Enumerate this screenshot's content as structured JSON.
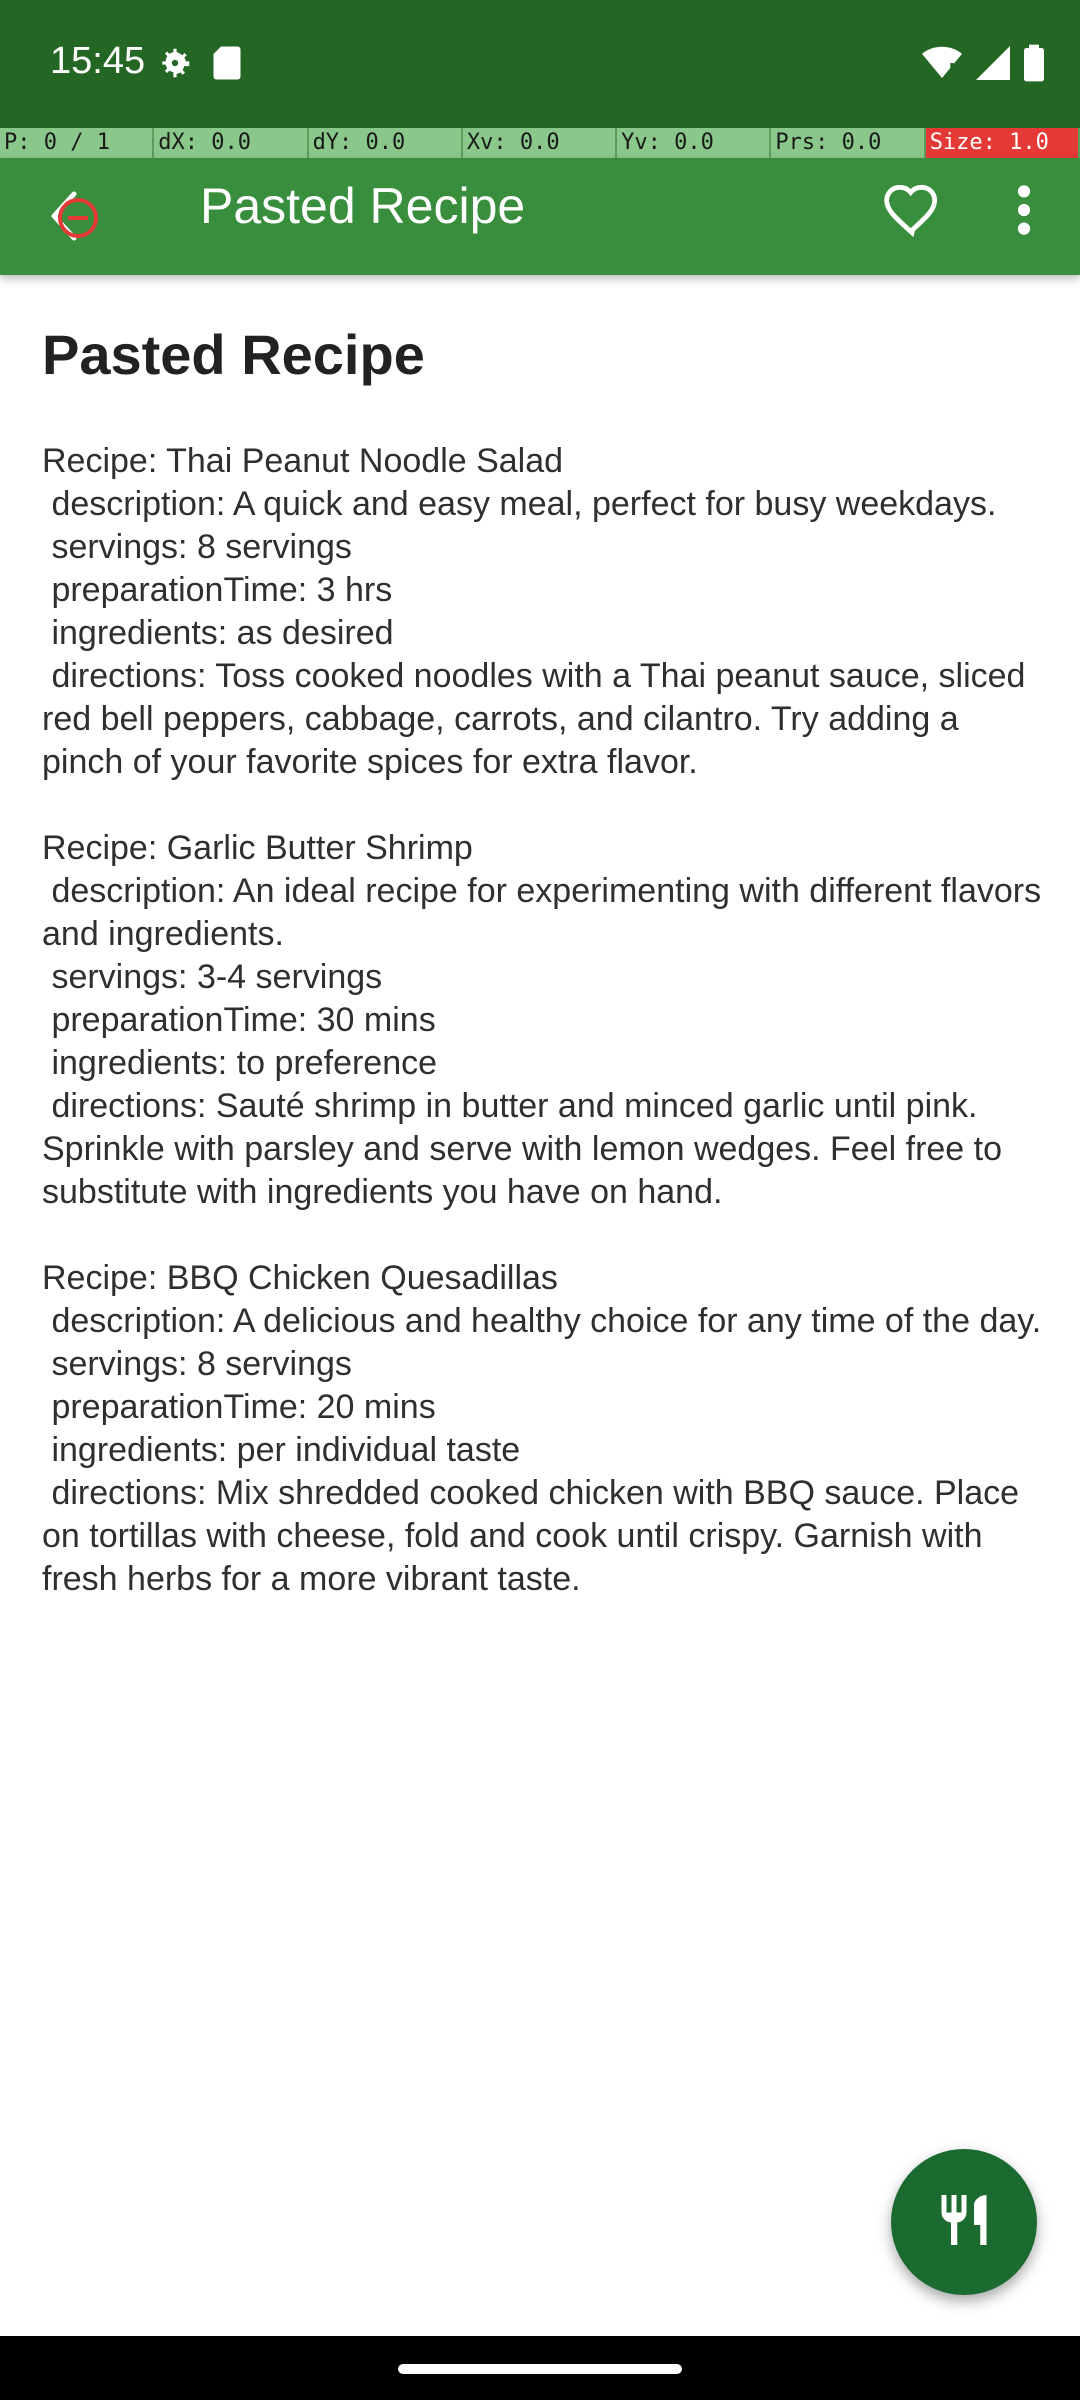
{
  "status_bar": {
    "time": "15:45",
    "icons": [
      "settings-icon",
      "sd-card-icon",
      "wifi-icon",
      "signal-icon",
      "battery-icon"
    ]
  },
  "pointer_overlay": {
    "cells": [
      "P: 0 / 1",
      "dX: 0.0",
      "dY: 0.0",
      "Xv: 0.0",
      "Yv: 0.0",
      "Prs: 0.0",
      "Size: 1.0"
    ]
  },
  "app_bar": {
    "title": "Pasted Recipe",
    "nav_icon": "back-icon",
    "favorite_icon": "heart-icon",
    "more_icon": "more-vert-icon"
  },
  "content": {
    "heading": "Pasted Recipe",
    "recipes": [
      {
        "name": "Recipe: Thai Peanut Noodle Salad",
        "description": " description: A quick and easy meal, perfect for busy weekdays.",
        "servings": " servings: 8 servings",
        "preparationTime": " preparationTime: 3 hrs",
        "ingredients": " ingredients: as desired",
        "directions": " directions: Toss cooked noodles with a Thai peanut sauce, sliced red bell peppers, cabbage, carrots, and cilantro. Try adding a pinch of your favorite spices for extra flavor."
      },
      {
        "name": "Recipe: Garlic Butter Shrimp",
        "description": " description: An ideal recipe for experimenting with different flavors and ingredients.",
        "servings": " servings: 3-4 servings",
        "preparationTime": " preparationTime: 30 mins",
        "ingredients": " ingredients: to preference",
        "directions": " directions: Sauté shrimp in butter and minced garlic until pink. Sprinkle with parsley and serve with lemon wedges. Feel free to substitute with ingredients you have on hand."
      },
      {
        "name": "Recipe: BBQ Chicken Quesadillas",
        "description": " description: A delicious and healthy choice for any time of the day.",
        "servings": " servings: 8 servings",
        "preparationTime": " preparationTime: 20 mins",
        "ingredients": " ingredients: per individual taste",
        "directions": " directions: Mix shredded cooked chicken with BBQ sauce. Place on tortillas with cheese, fold and cook until crispy. Garnish with fresh herbs for a more vibrant taste."
      }
    ]
  },
  "fab": {
    "icon": "restaurant-icon"
  },
  "colors": {
    "status_bar": "#246624",
    "app_bar": "#388e3c",
    "fab": "#1b6a2f",
    "nav_bar": "#000000"
  }
}
